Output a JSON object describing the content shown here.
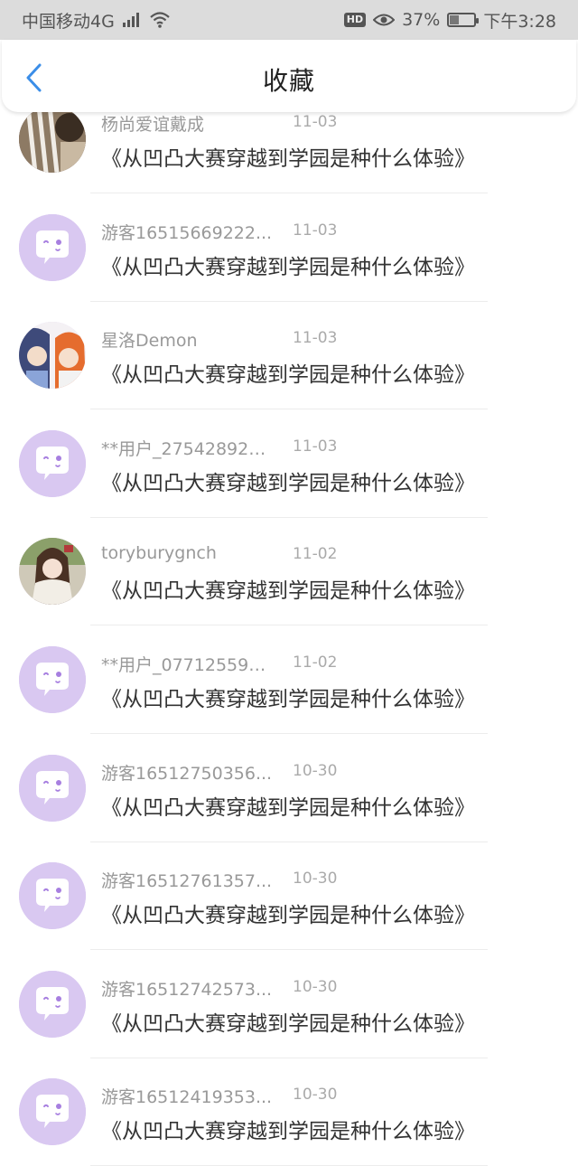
{
  "status_bar": {
    "carrier": "中国移动4G",
    "network": "4G",
    "hd": "HD",
    "battery": "37%",
    "battery_level": 0.37,
    "time": "下午3:28"
  },
  "header": {
    "title": "收藏",
    "back_icon": "chevron-left-icon"
  },
  "colors": {
    "accent": "#3b8ee8",
    "avatar_default": "#d9c8f1",
    "avatar_bubble": "#ffffff",
    "avatar_eye": "#a77fe0"
  },
  "favorites": [
    {
      "user": "杨尚爱谊戴成",
      "time": "11-03",
      "title": "《从凹凸大赛穿越到学园是种什么体验》",
      "avatar": "photo-striped"
    },
    {
      "user": "游客16515669222...",
      "time": "11-03",
      "title": "《从凹凸大赛穿越到学园是种什么体验》",
      "avatar": "default-chat-bubble"
    },
    {
      "user": "星洛Demon",
      "time": "11-03",
      "title": "《从凹凸大赛穿越到学园是种什么体验》",
      "avatar": "anime-pair"
    },
    {
      "user": "**用户_275428927...",
      "time": "11-03",
      "title": "《从凹凸大赛穿越到学园是种什么体验》",
      "avatar": "default-chat-bubble"
    },
    {
      "user": "toryburygnch",
      "time": "11-02",
      "title": "《从凹凸大赛穿越到学园是种什么体验》",
      "avatar": "photo-girl"
    },
    {
      "user": "**用户_077125596...",
      "time": "11-02",
      "title": "《从凹凸大赛穿越到学园是种什么体验》",
      "avatar": "default-chat-bubble"
    },
    {
      "user": "游客16512750356...",
      "time": "10-30",
      "title": "《从凹凸大赛穿越到学园是种什么体验》",
      "avatar": "default-chat-bubble"
    },
    {
      "user": "游客16512761357...",
      "time": "10-30",
      "title": "《从凹凸大赛穿越到学园是种什么体验》",
      "avatar": "default-chat-bubble"
    },
    {
      "user": "游客16512742573...",
      "time": "10-30",
      "title": "《从凹凸大赛穿越到学园是种什么体验》",
      "avatar": "default-chat-bubble"
    },
    {
      "user": "游客16512419353...",
      "time": "10-30",
      "title": "《从凹凸大赛穿越到学园是种什么体验》",
      "avatar": "default-chat-bubble"
    }
  ]
}
